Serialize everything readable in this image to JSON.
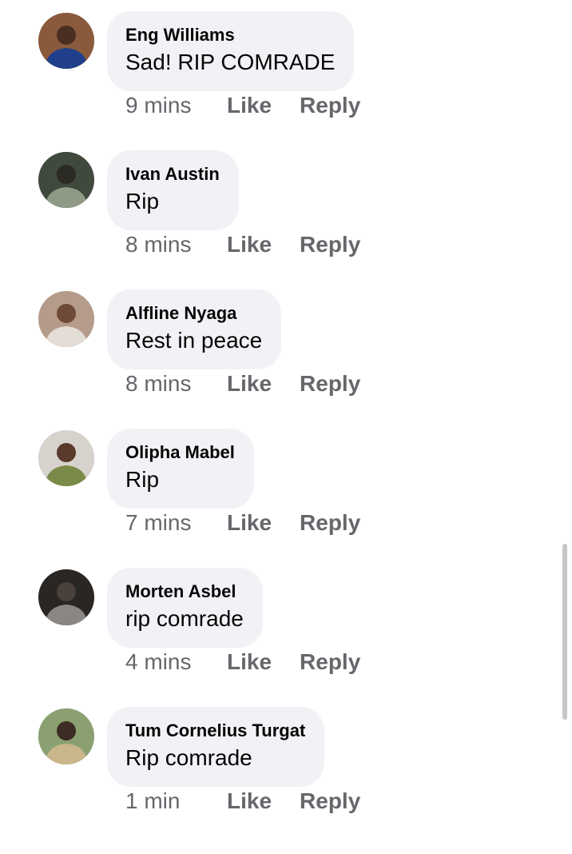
{
  "comments": [
    {
      "author": "Eng Williams",
      "text": "Sad! RIP COMRADE",
      "time": "9 mins",
      "like": "Like",
      "reply": "Reply",
      "avatar_colors": {
        "bg": "#8a5a3c",
        "accent": "#1f3f8a",
        "skin": "#4a2e22"
      }
    },
    {
      "author": "Ivan Austin",
      "text": "Rip",
      "time": "8 mins",
      "like": "Like",
      "reply": "Reply",
      "avatar_colors": {
        "bg": "#3f4a3c",
        "accent": "#8e9a86",
        "skin": "#2c2a24"
      }
    },
    {
      "author": "Alfline Nyaga",
      "text": "Rest in peace",
      "time": "8 mins",
      "like": "Like",
      "reply": "Reply",
      "avatar_colors": {
        "bg": "#b59b8a",
        "accent": "#e3ddd5",
        "skin": "#6e4a38"
      }
    },
    {
      "author": "Olipha Mabel",
      "text": "Rip",
      "time": "7 mins",
      "like": "Like",
      "reply": "Reply",
      "avatar_colors": {
        "bg": "#d8d2cc",
        "accent": "#7a8a48",
        "skin": "#5a3a2c"
      }
    },
    {
      "author": "Morten Asbel",
      "text": "rip comrade",
      "time": "4 mins",
      "like": "Like",
      "reply": "Reply",
      "avatar_colors": {
        "bg": "#2a2624",
        "accent": "#8a8684",
        "skin": "#4a403c"
      }
    },
    {
      "author": "Tum Cornelius Turgat",
      "text": "Rip comrade",
      "time": "1 min",
      "like": "Like",
      "reply": "Reply",
      "avatar_colors": {
        "bg": "#8aa070",
        "accent": "#c9b68a",
        "skin": "#3c2c24"
      }
    }
  ],
  "colors": {
    "bubble": "#f0f2f5",
    "meta": "#65676b",
    "text": "#050505",
    "scrollbar": "#c7c7c7"
  }
}
